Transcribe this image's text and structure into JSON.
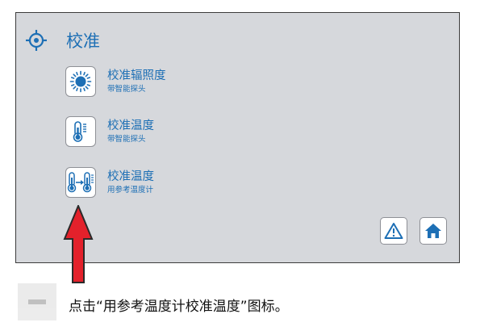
{
  "header": {
    "title": "校准",
    "icon": "crosshair-icon"
  },
  "menu": {
    "items": [
      {
        "title": "校准辐照度",
        "subtitle": "带智能探头",
        "icon": "sun-icon"
      },
      {
        "title": "校准温度",
        "subtitle": "带智能探头",
        "icon": "thermometer-icon"
      },
      {
        "title": "校准温度",
        "subtitle": "用参考温度计",
        "icon": "reference-thermometer-icon"
      }
    ]
  },
  "nav": {
    "warning_icon": "warning-icon",
    "home_icon": "home-icon"
  },
  "colors": {
    "accent": "#1d6fb5",
    "screen_bg": "#d6d8dc",
    "arrow": "#e3212b"
  },
  "caption": {
    "text": "点击“用参考温度计校准温度”图标。"
  }
}
